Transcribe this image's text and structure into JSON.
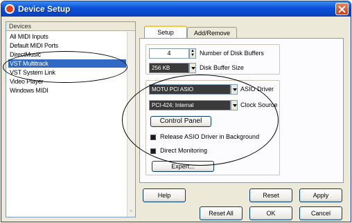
{
  "window": {
    "title": "Device Setup"
  },
  "devices": {
    "header": "Devices",
    "items": [
      "All MIDI Inputs",
      "Default MIDI Ports",
      "DirectMusic",
      "VST Multitrack",
      "VST System Link",
      "Video Player",
      "Windows MIDI"
    ],
    "selected": "VST Multitrack"
  },
  "tabs": [
    {
      "label": "Setup",
      "active": true
    },
    {
      "label": "Add/Remove",
      "active": false
    }
  ],
  "setup": {
    "disk_buffers_value": "4",
    "disk_buffers_label": "Number of Disk Buffers",
    "buffer_size_value": "256 KB",
    "buffer_size_label": "Disk Buffer Size",
    "asio_driver_value": "MOTU PCI ASIO",
    "asio_driver_label": "ASIO Driver",
    "clock_source_value": "PCI-424: Internal",
    "clock_source_label": "Clock Source",
    "control_panel_label": "Control Panel",
    "release_asio_label": "Release ASIO Driver in Background",
    "direct_monitoring_label": "Direct Monitoring",
    "expert_label": "Expert..."
  },
  "buttons": {
    "help": "Help",
    "reset": "Reset",
    "apply": "Apply",
    "reset_all": "Reset All",
    "ok": "OK",
    "cancel": "Cancel"
  },
  "colors": {
    "selection": "#316ac5",
    "titlebar": "#0a4fd6",
    "dialog_bg": "#ece9d8"
  }
}
